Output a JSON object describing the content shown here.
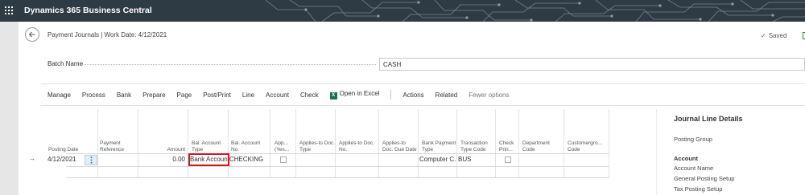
{
  "app": {
    "title": "Dynamics 365 Business Central"
  },
  "page": {
    "title": "Payment Journals | Work Date: 4/12/2021",
    "saved_label": "Saved"
  },
  "batch": {
    "label": "Batch Name",
    "value": "CASH"
  },
  "actions": {
    "manage": "Manage",
    "process": "Process",
    "bank": "Bank",
    "prepare": "Prepare",
    "page": "Page",
    "post_print": "Post/Print",
    "line": "Line",
    "account": "Account",
    "check": "Check",
    "open_in_excel": "Open in Excel",
    "actions": "Actions",
    "related": "Related",
    "fewer_options": "Fewer options"
  },
  "columns": {
    "posting_date": "Posting Date",
    "payment_reference": "Payment Reference",
    "amount": "Amount",
    "bal_account_type": "Bal. Account Type",
    "bal_account_no": "Bal. Account No.",
    "applies_yes": "App... (Yes...",
    "applies_to_doc_type": "Applies-to Doc. Type",
    "applies_to_doc_no": "Applies-to Doc. No.",
    "applies_to_doc_due_date": "Applies-to Doc. Due Date",
    "bank_payment_type": "Bank Payment Type",
    "transaction_type_code": "Transaction Type Code",
    "check_printed": "Check Prin...",
    "department_code": "Department Code",
    "customergroup_code": "Customergro... Code"
  },
  "row": {
    "posting_date": "4/12/2021",
    "amount": "0.00",
    "bal_account_type": "Bank Account",
    "bal_account_no": "CHECKING",
    "bank_payment_type": "Computer C...",
    "transaction_type_code": "BUS"
  },
  "details": {
    "title": "Journal Line Details",
    "posting_group": "Posting Group",
    "account": "Account",
    "account_name": "Account Name",
    "general_posting_setup": "General Posting Setup",
    "tax_posting_setup": "Tax Posting Setup"
  },
  "colors": {
    "topbar": "#2e3a44",
    "highlight": "#d9151b",
    "excel": "#1e7145"
  }
}
